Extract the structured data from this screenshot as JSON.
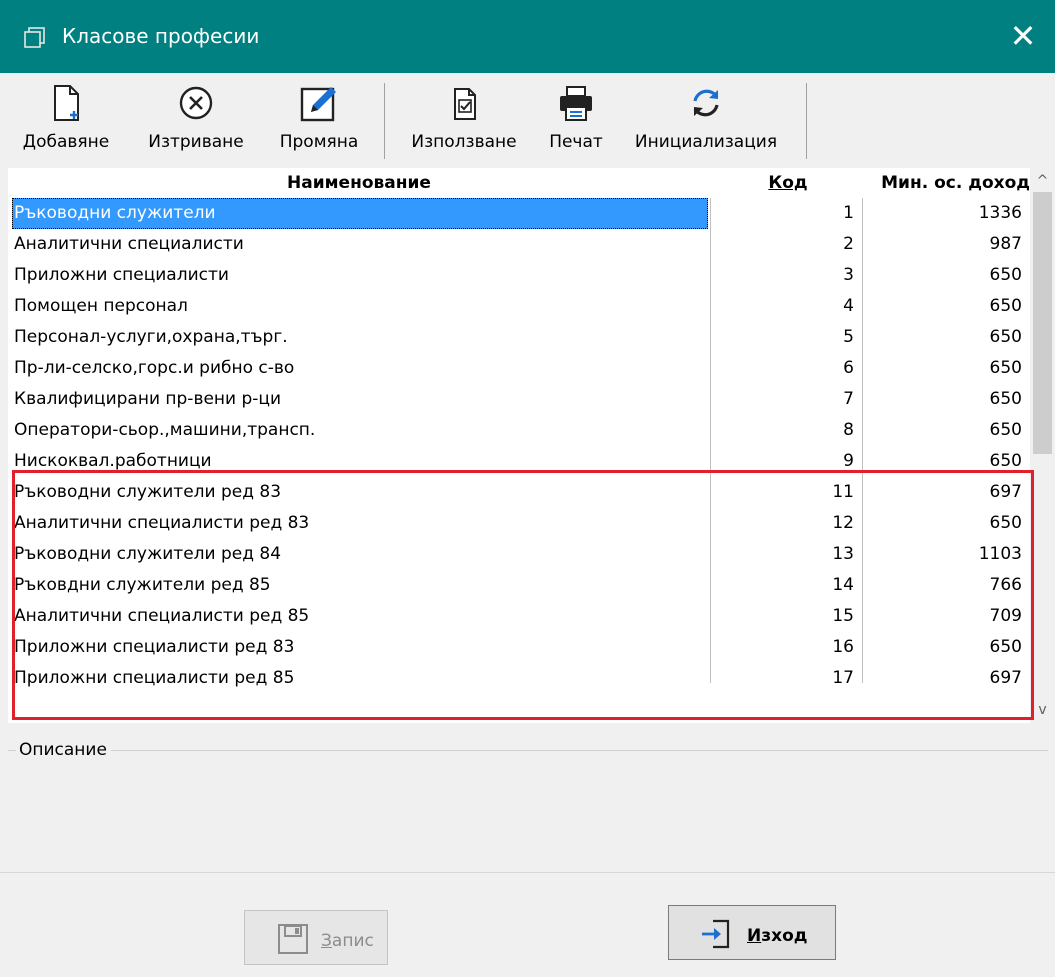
{
  "window": {
    "title": "Класове професии",
    "close_glyph": "✕"
  },
  "toolbar": {
    "add_label": "Добавяне",
    "delete_label": "Изтриване",
    "edit_label": "Промяна",
    "use_label": "Използване",
    "print_label": "Печат",
    "init_label": "Инициализация"
  },
  "grid": {
    "columns": {
      "name": "Наименование",
      "code": "Код",
      "income": "Мин. ос. доход"
    },
    "rows": [
      {
        "name": "Ръководни служители",
        "code": "1",
        "income": "1336"
      },
      {
        "name": "Аналитични специалисти",
        "code": "2",
        "income": "987"
      },
      {
        "name": "Приложни специалисти",
        "code": "3",
        "income": "650"
      },
      {
        "name": "Помощен персонал",
        "code": "4",
        "income": "650"
      },
      {
        "name": "Персонал-услуги,охрана,търг.",
        "code": "5",
        "income": "650"
      },
      {
        "name": "Пр-ли-селско,горс.и рибно с-во",
        "code": "6",
        "income": "650"
      },
      {
        "name": "Квалифицирани пр-вени р-ци",
        "code": "7",
        "income": "650"
      },
      {
        "name": "Оператори-сьор.,машини,трансп.",
        "code": "8",
        "income": "650"
      },
      {
        "name": "Нискоквал.работници",
        "code": "9",
        "income": "650"
      },
      {
        "name": "Ръководни служители ред 83",
        "code": "11",
        "income": "697"
      },
      {
        "name": "Аналитични специалисти ред 83",
        "code": "12",
        "income": "650"
      },
      {
        "name": "Ръководни служители ред 84",
        "code": "13",
        "income": "1103"
      },
      {
        "name": "Ръковдни служители ред 85",
        "code": "14",
        "income": "766"
      },
      {
        "name": "Аналитични специалисти ред 85",
        "code": "15",
        "income": "709"
      },
      {
        "name": "Приложни специалисти ред 83",
        "code": "16",
        "income": "650"
      },
      {
        "name": "Приложни специалисти ред 85",
        "code": "17",
        "income": "697"
      }
    ],
    "selected_row": 0
  },
  "scrollbar": {
    "up_glyph": "^",
    "down_glyph": "v"
  },
  "description": {
    "legend": "Описание"
  },
  "buttons": {
    "save_label": "Запис",
    "save_accel": "З",
    "save_rest": "апис",
    "exit_accel": "И",
    "exit_rest": "зход"
  },
  "colors": {
    "titlebar": "#008080",
    "selection": "#3399ff",
    "highlight_frame": "#e0202a",
    "exit_arrow": "#1e6fd0"
  },
  "icons": {
    "window": "window-icon",
    "add": "new-document-icon",
    "delete": "delete-circle-icon",
    "edit": "pencil-edit-icon",
    "use": "checked-document-icon",
    "print": "printer-icon",
    "init": "refresh-icon",
    "save": "floppy-disk-icon",
    "exit": "exit-arrow-icon"
  }
}
